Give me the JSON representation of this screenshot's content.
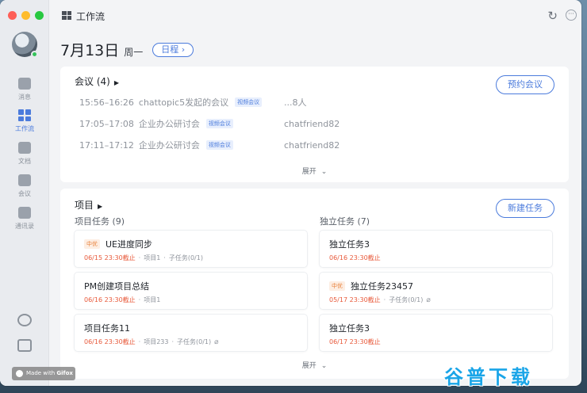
{
  "titlebar": {
    "title": "工作流",
    "refresh_icon": "refresh-icon",
    "more_icon": "more-icon"
  },
  "sidebar": {
    "items": [
      {
        "label": "消息",
        "icon": "message-icon",
        "active": false
      },
      {
        "label": "工作流",
        "icon": "workflow-icon",
        "active": true
      },
      {
        "label": "文档",
        "icon": "document-icon",
        "active": false
      },
      {
        "label": "会议",
        "icon": "video-icon",
        "active": false
      },
      {
        "label": "通讯录",
        "icon": "contacts-icon",
        "active": false
      }
    ],
    "bottom_icons": [
      "phone-icon",
      "bookmark-icon"
    ]
  },
  "header": {
    "date": "7月13日",
    "weekday": "周一",
    "schedule_button": "日程"
  },
  "meetings": {
    "title": "会议 (4)",
    "create_button": "预约会议",
    "rows": [
      {
        "time": "15:56–16:26",
        "subject": "chattopic5发起的会议",
        "badge": "视频会议",
        "who": "...8人"
      },
      {
        "time": "17:05–17:08",
        "subject": "企业办公研讨会",
        "badge": "视频会议",
        "who": "chatfriend82"
      },
      {
        "time": "17:11–17:12",
        "subject": "企业办公研讨会",
        "badge": "视频会议",
        "who": "chatfriend82"
      }
    ],
    "expand": "展开"
  },
  "projects": {
    "title": "项目",
    "create_button": "新建任务",
    "left_title": "项目任务 (9)",
    "right_title": "独立任务 (7)",
    "left_tasks": [
      {
        "priority": "中优",
        "name": "UE进度同步",
        "due": "06/15 23:30截止",
        "meta": [
          "项目1",
          "子任务(0/1)"
        ],
        "attach": false
      },
      {
        "priority": "",
        "name": "PM创建项目总结",
        "due": "06/16 23:30截止",
        "meta": [
          "项目1"
        ],
        "attach": false
      },
      {
        "priority": "",
        "name": "项目任务11",
        "due": "06/16 23:30截止",
        "meta": [
          "项目233",
          "子任务(0/1)"
        ],
        "attach": true
      }
    ],
    "right_tasks": [
      {
        "priority": "",
        "name": "独立任务3",
        "due": "06/16 23:30截止",
        "meta": [],
        "attach": false
      },
      {
        "priority": "中优",
        "name": "独立任务23457",
        "due": "05/17 23:30截止",
        "meta": [
          "子任务(0/1)"
        ],
        "attach": true
      },
      {
        "priority": "",
        "name": "独立任务3",
        "due": "06/17 23:30截止",
        "meta": [],
        "attach": false
      }
    ],
    "expand": "展开"
  },
  "overlay": {
    "gifox_prefix": "Made with",
    "gifox_brand": "Gifox",
    "watermark": "谷普下载"
  },
  "colors": {
    "accent": "#4b7bdc",
    "due": "#e8593a",
    "priority": "#e8803a"
  }
}
